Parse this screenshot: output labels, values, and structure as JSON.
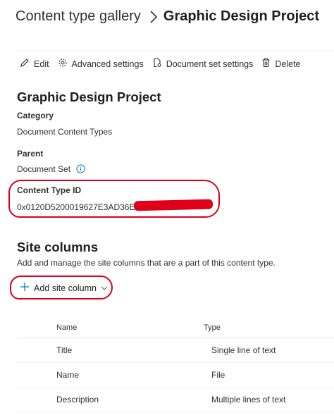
{
  "breadcrumb": {
    "root": "Content type gallery",
    "current": "Graphic Design Project"
  },
  "toolbar": {
    "edit": "Edit",
    "advanced": "Advanced settings",
    "docset": "Document set settings",
    "delete": "Delete"
  },
  "details": {
    "title": "Graphic Design Project",
    "category_label": "Category",
    "category_value": "Document Content Types",
    "parent_label": "Parent",
    "parent_value": "Document Set",
    "ctid_label": "Content Type ID",
    "ctid_value": "0x0120D5200019627E3AD36E534"
  },
  "site_columns": {
    "title": "Site columns",
    "description": "Add and manage the site columns that are a part of this content type.",
    "add_button": "Add site column"
  },
  "table": {
    "headers": {
      "name": "Name",
      "type": "Type"
    },
    "rows": [
      {
        "name": "Title",
        "type": "Single line of text"
      },
      {
        "name": "Name",
        "type": "File"
      },
      {
        "name": "Description",
        "type": "Multiple lines of text"
      }
    ]
  },
  "colors": {
    "annotation_red": "#d9001b",
    "text": "#323130",
    "info_blue": "#0078d4"
  }
}
